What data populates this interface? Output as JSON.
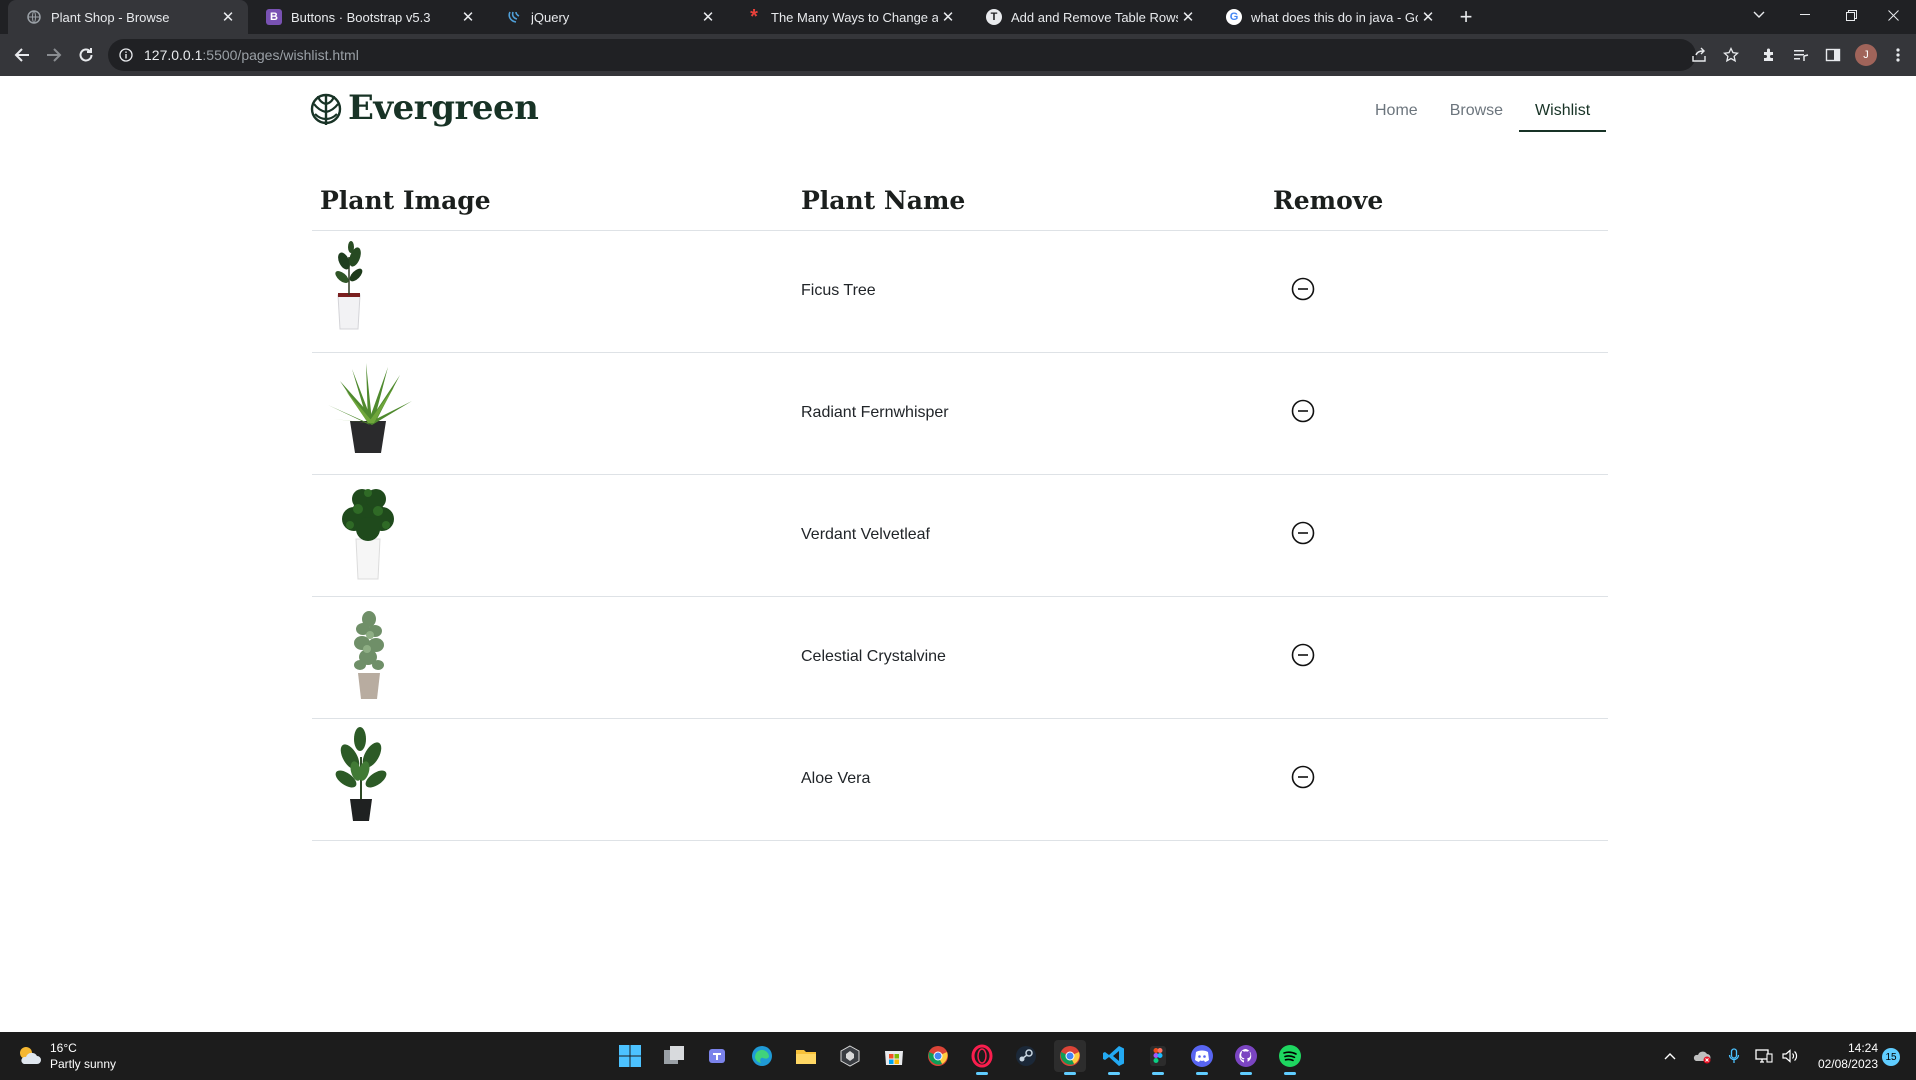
{
  "browser": {
    "tabs": [
      {
        "title": "Plant Shop - Browse",
        "favicon": "page-icon",
        "active": true
      },
      {
        "title": "Buttons · Bootstrap v5.3",
        "favicon": "bootstrap-icon",
        "favicon_letter": "B",
        "favicon_color": "#7952b3"
      },
      {
        "title": "jQuery",
        "favicon": "jquery-icon"
      },
      {
        "title": "The Many Ways to Change an SV",
        "favicon": "css-tricks-icon",
        "favicon_letter": "*",
        "favicon_color": "#e8413b"
      },
      {
        "title": "Add and Remove Table Rows Dy",
        "favicon": "tutorial-icon",
        "favicon_letter": "T"
      },
      {
        "title": "what does this do in java - Googl",
        "favicon": "google-icon",
        "favicon_letter": "G"
      }
    ],
    "new_tab_label": "+",
    "address": {
      "host": "127.0.0.1",
      "rest": ":5500/pages/wishlist.html"
    },
    "profile_initial": "J"
  },
  "site": {
    "brand": "Evergreen",
    "nav": [
      {
        "label": "Home",
        "active": false
      },
      {
        "label": "Browse",
        "active": false
      },
      {
        "label": "Wishlist",
        "active": true
      }
    ]
  },
  "wishlist": {
    "headers": [
      "Plant Image",
      "Plant Name",
      "Remove"
    ],
    "rows": [
      {
        "name": "Ficus Tree",
        "image": "ficus-tree-image"
      },
      {
        "name": "Radiant Fernwhisper",
        "image": "radiant-fernwhisper-image"
      },
      {
        "name": "Verdant Velvetleaf",
        "image": "verdant-velvetleaf-image"
      },
      {
        "name": "Celestial Crystalvine",
        "image": "celestial-crystalvine-image"
      },
      {
        "name": "Aloe Vera",
        "image": "aloe-vera-image"
      }
    ],
    "remove_icon": "dash-circle-icon"
  },
  "taskbar": {
    "weather": {
      "temp": "16°C",
      "condition": "Partly sunny"
    },
    "apps": [
      "start",
      "task-view",
      "teams",
      "edge",
      "file-explorer",
      "unity",
      "store",
      "chrome",
      "opera-gx",
      "steam",
      "chrome-dev",
      "vscode",
      "figma",
      "discord",
      "github-desktop",
      "spotify"
    ],
    "time": "14:24",
    "date": "02/08/2023",
    "notifications": "15"
  },
  "colors": {
    "brand": "#183326",
    "accent": "#183326",
    "muted": "#6c757d",
    "divider": "#dee2e6"
  }
}
